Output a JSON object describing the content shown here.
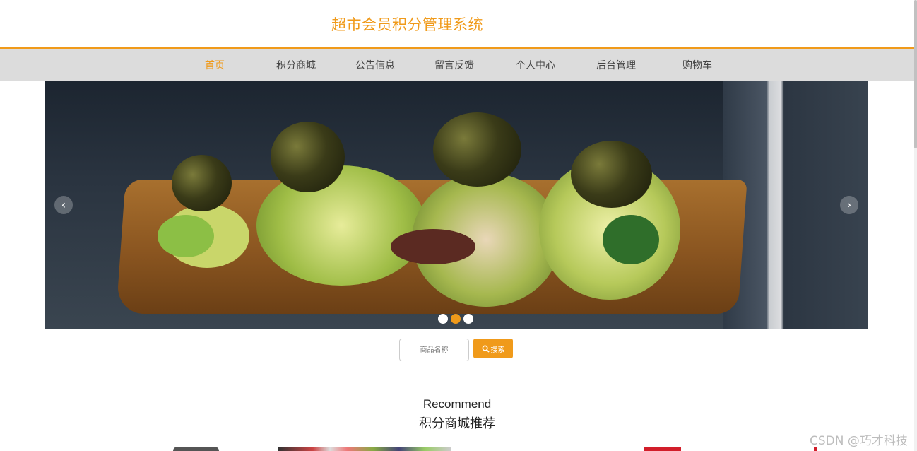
{
  "header": {
    "title": "超市会员积分管理系统"
  },
  "nav": {
    "items": [
      {
        "label": "首页",
        "active": true
      },
      {
        "label": "积分商城",
        "active": false
      },
      {
        "label": "公告信息",
        "active": false
      },
      {
        "label": "留言反馈",
        "active": false
      },
      {
        "label": "个人中心",
        "active": false
      },
      {
        "label": "后台管理",
        "active": false
      },
      {
        "label": "购物车",
        "active": false
      }
    ]
  },
  "carousel": {
    "prev_icon": "chevron-left-icon",
    "next_icon": "chevron-right-icon",
    "slide_count": 3,
    "active_slide": 2
  },
  "search": {
    "placeholder": "商品名称",
    "button_label": "搜索",
    "button_icon": "search-icon"
  },
  "recommend": {
    "title_en": "Recommend",
    "title_cn": "积分商城推荐"
  },
  "watermark": "CSDN @巧才科技",
  "colors": {
    "accent": "#f09a1a",
    "nav_bg": "#dcdcdc",
    "text": "#444444"
  }
}
